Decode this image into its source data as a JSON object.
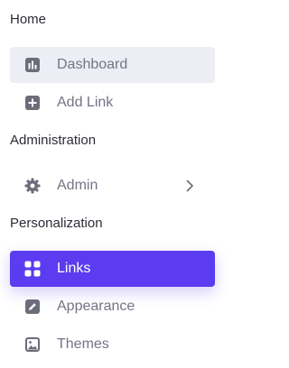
{
  "sections": {
    "home": {
      "title": "Home",
      "items": [
        {
          "label": "Dashboard",
          "icon": "chart-bar-icon"
        },
        {
          "label": "Add Link",
          "icon": "plus-square-icon"
        }
      ]
    },
    "administration": {
      "title": "Administration",
      "items": [
        {
          "label": "Admin",
          "icon": "gear-icon"
        }
      ]
    },
    "personalization": {
      "title": "Personalization",
      "items": [
        {
          "label": "Links",
          "icon": "grid-icon"
        },
        {
          "label": "Appearance",
          "icon": "pencil-square-icon"
        },
        {
          "label": "Themes",
          "icon": "image-icon"
        }
      ]
    }
  },
  "colors": {
    "accent": "#5b3cf0",
    "highlight_bg": "#ededf5",
    "icon": "#6b6d7a",
    "label": "#737584",
    "heading": "#2b2d36"
  }
}
